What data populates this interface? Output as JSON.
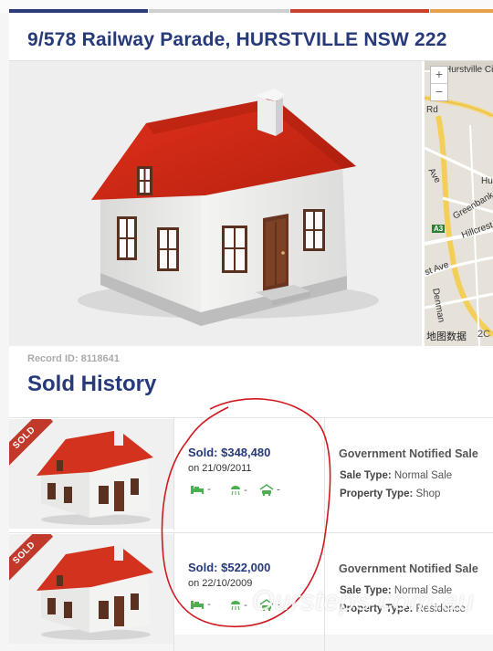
{
  "header": {
    "title": "9/578 Railway Parade, HURSTVILLE NSW 222"
  },
  "map": {
    "zoom_in": "+",
    "zoom_out": "−",
    "labels": {
      "hurstville_city": "Hurstville City Li",
      "hu": "Hu",
      "rd": "Rd",
      "ave": "Ave",
      "greenbank": "Greenbank St",
      "a3": "A3",
      "hillcrest": "Hillcrest",
      "st_ave": "st Ave",
      "denman": "Denman"
    },
    "attribution": "地图数据",
    "attribution_year": "2C"
  },
  "record": {
    "label": "Record ID: 8118641"
  },
  "section": {
    "title": "Sold History"
  },
  "sales": [
    {
      "ribbon": "SOLD",
      "price": "Sold: $348,480",
      "date": "on 21/09/2011",
      "beds": "-",
      "baths": "-",
      "cars": "-",
      "sale_title": "Government Notified Sale",
      "sale_type_label": "Sale Type:",
      "sale_type_value": "Normal Sale",
      "property_type_label": "Property Type:",
      "property_type_value": "Shop"
    },
    {
      "ribbon": "SOLD",
      "price": "Sold: $522,000",
      "date": "on 22/10/2009",
      "beds": "-",
      "baths": "-",
      "cars": "-",
      "sale_title": "Government Notified Sale",
      "sale_type_label": "Sale Type:",
      "sale_type_value": "Normal Sale",
      "property_type_label": "Property Type:",
      "property_type_value": "Residence"
    }
  ],
  "watermark": "Oursteps.com.au",
  "colors": {
    "brand_navy": "#263a7a",
    "ribbon_red": "#c0392b",
    "annotation_red": "#d0181e",
    "icon_green": "#4caf50"
  }
}
